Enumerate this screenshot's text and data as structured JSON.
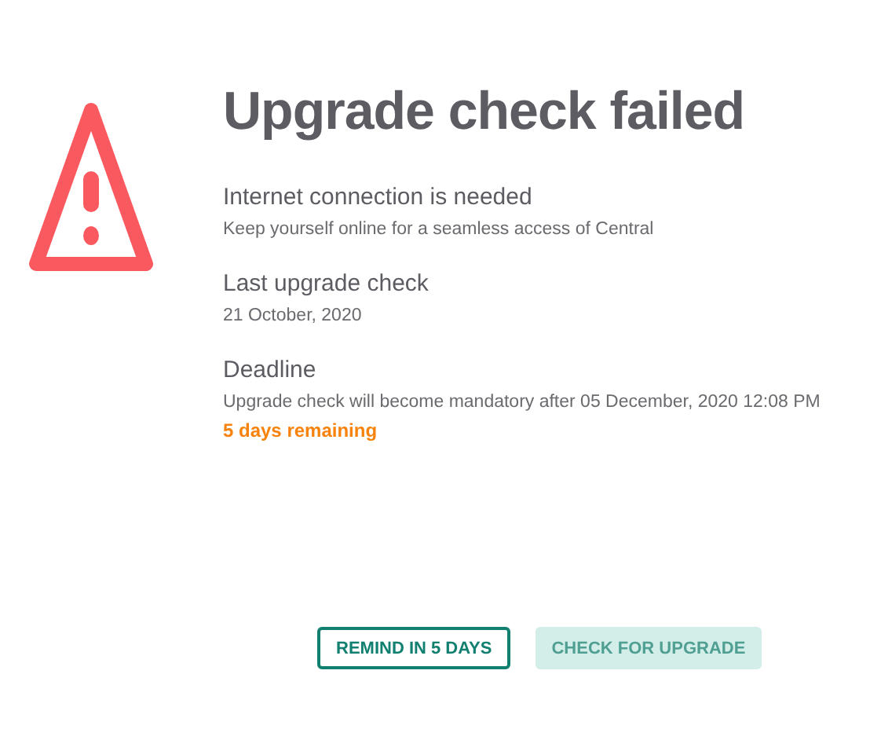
{
  "title": "Upgrade check failed",
  "sections": [
    {
      "heading": "Internet connection is needed",
      "text": "Keep yourself online for a seamless access of Central"
    },
    {
      "heading": "Last upgrade check",
      "text": "21 October, 2020"
    },
    {
      "heading": "Deadline",
      "text": "Upgrade check will become mandatory after 05 December, 2020 12:08 PM",
      "note": "5 days remaining"
    }
  ],
  "buttons": [
    {
      "label": "REMIND IN 5 DAYS",
      "kind": "outline",
      "disabled": false
    },
    {
      "label": "CHECK FOR UPGRADE",
      "kind": "filled",
      "disabled": true
    }
  ]
}
